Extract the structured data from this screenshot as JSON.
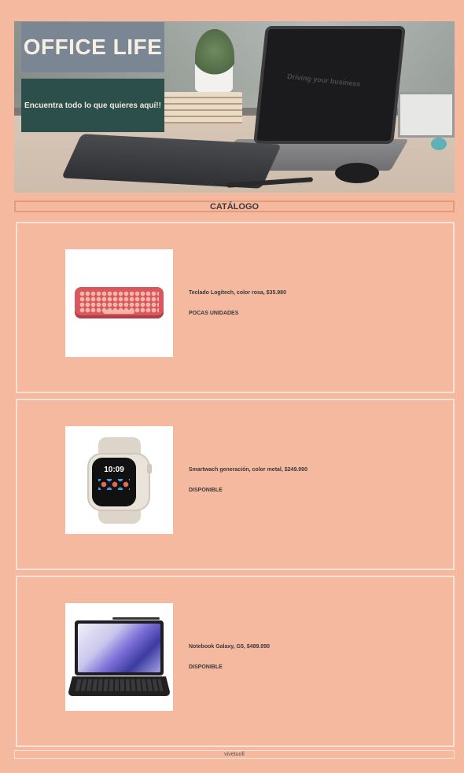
{
  "hero": {
    "title": "OFFICE LIFE",
    "tagline": "Encuentra todo lo que quieres aquí!!",
    "screen_text": "Driving your business"
  },
  "catalog": {
    "heading": "CATÁLOGO",
    "products": [
      {
        "name": "Teclado Logitech, color rosa, $35.980",
        "status": "POCAS UNIDADES",
        "image": "pink-keyboard"
      },
      {
        "name": "Smartwach generación, color metal, $249.990",
        "status": "DISPONIBLE",
        "image": "smartwatch",
        "watch_time": "10:09"
      },
      {
        "name": "Notebook Galaxy, G5, $489.990",
        "status": "DISPONIBLE",
        "image": "tablet-keyboard"
      }
    ]
  },
  "footer": {
    "text": "vivetuofi"
  },
  "colors": {
    "background": "#f5b9a0",
    "title_box": "#7b8694",
    "tagline_box": "#2d4f4b",
    "header_border": "#e69a78",
    "card_border": "#fbe1d5"
  }
}
